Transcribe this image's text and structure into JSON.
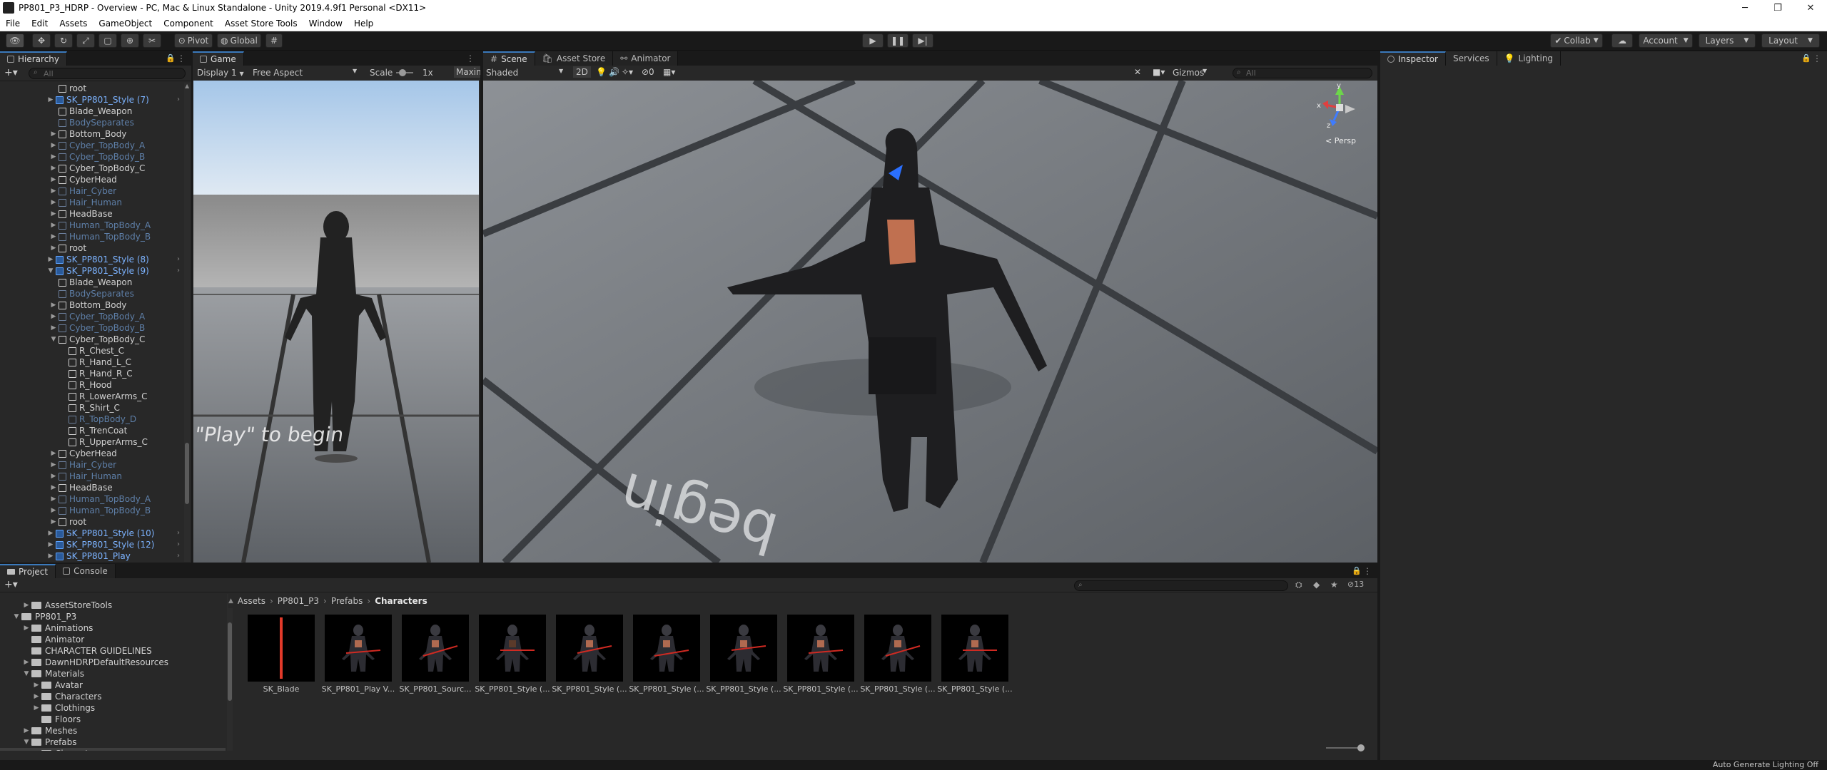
{
  "window": {
    "title": "PP801_P3_HDRP - Overview - PC, Mac & Linux Standalone - Unity 2019.4.9f1 Personal <DX11>"
  },
  "menu": [
    "File",
    "Edit",
    "Assets",
    "GameObject",
    "Component",
    "Asset Store Tools",
    "Window",
    "Help"
  ],
  "toolbar": {
    "pivot": "Pivot",
    "global": "Global",
    "collab": "Collab",
    "account": "Account",
    "layers": "Layers",
    "layout": "Layout"
  },
  "hierarchy": {
    "tab": "Hierarchy",
    "search_placeholder": "All",
    "rows": [
      {
        "label": "root",
        "depth": 1,
        "style": "white",
        "arrow": false,
        "icon": "normal"
      },
      {
        "label": "SK_PP801_Style (7)",
        "depth": 0,
        "style": "blue",
        "arrow": true,
        "icon": "blue",
        "chev": true
      },
      {
        "label": "Blade_Weapon",
        "depth": 1,
        "style": "white",
        "arrow": false,
        "icon": "normal"
      },
      {
        "label": "BodySeparates",
        "depth": 1,
        "style": "dim",
        "arrow": false,
        "icon": "dim"
      },
      {
        "label": "Bottom_Body",
        "depth": 1,
        "style": "white",
        "arrow": true,
        "icon": "normal"
      },
      {
        "label": "Cyber_TopBody_A",
        "depth": 1,
        "style": "dim",
        "arrow": true,
        "icon": "dim"
      },
      {
        "label": "Cyber_TopBody_B",
        "depth": 1,
        "style": "dim",
        "arrow": true,
        "icon": "dim"
      },
      {
        "label": "Cyber_TopBody_C",
        "depth": 1,
        "style": "white",
        "arrow": true,
        "icon": "normal"
      },
      {
        "label": "CyberHead",
        "depth": 1,
        "style": "white",
        "arrow": true,
        "icon": "normal"
      },
      {
        "label": "Hair_Cyber",
        "depth": 1,
        "style": "dim",
        "arrow": true,
        "icon": "dim"
      },
      {
        "label": "Hair_Human",
        "depth": 1,
        "style": "dim",
        "arrow": true,
        "icon": "dim"
      },
      {
        "label": "HeadBase",
        "depth": 1,
        "style": "white",
        "arrow": true,
        "icon": "normal"
      },
      {
        "label": "Human_TopBody_A",
        "depth": 1,
        "style": "dim",
        "arrow": true,
        "icon": "dim"
      },
      {
        "label": "Human_TopBody_B",
        "depth": 1,
        "style": "dim",
        "arrow": true,
        "icon": "dim"
      },
      {
        "label": "root",
        "depth": 1,
        "style": "white",
        "arrow": true,
        "icon": "normal"
      },
      {
        "label": "SK_PP801_Style (8)",
        "depth": 0,
        "style": "blue",
        "arrow": true,
        "icon": "blue",
        "chev": true
      },
      {
        "label": "SK_PP801_Style (9)",
        "depth": 0,
        "style": "blue",
        "arrow": true,
        "open": true,
        "icon": "blue",
        "chev": true
      },
      {
        "label": "Blade_Weapon",
        "depth": 1,
        "style": "white",
        "arrow": false,
        "icon": "normal"
      },
      {
        "label": "BodySeparates",
        "depth": 1,
        "style": "dim",
        "arrow": false,
        "icon": "dim"
      },
      {
        "label": "Bottom_Body",
        "depth": 1,
        "style": "white",
        "arrow": true,
        "icon": "normal"
      },
      {
        "label": "Cyber_TopBody_A",
        "depth": 1,
        "style": "dim",
        "arrow": true,
        "icon": "dim"
      },
      {
        "label": "Cyber_TopBody_B",
        "depth": 1,
        "style": "dim",
        "arrow": true,
        "icon": "dim"
      },
      {
        "label": "Cyber_TopBody_C",
        "depth": 1,
        "style": "white",
        "arrow": true,
        "open": true,
        "icon": "normal"
      },
      {
        "label": "R_Chest_C",
        "depth": 2,
        "style": "white",
        "arrow": false,
        "icon": "normal"
      },
      {
        "label": "R_Hand_L_C",
        "depth": 2,
        "style": "white",
        "arrow": false,
        "icon": "normal"
      },
      {
        "label": "R_Hand_R_C",
        "depth": 2,
        "style": "white",
        "arrow": false,
        "icon": "normal"
      },
      {
        "label": "R_Hood",
        "depth": 2,
        "style": "white",
        "arrow": false,
        "icon": "normal"
      },
      {
        "label": "R_LowerArms_C",
        "depth": 2,
        "style": "white",
        "arrow": false,
        "icon": "normal"
      },
      {
        "label": "R_Shirt_C",
        "depth": 2,
        "style": "white",
        "arrow": false,
        "icon": "normal"
      },
      {
        "label": "R_TopBody_D",
        "depth": 2,
        "style": "dim",
        "arrow": false,
        "icon": "dim"
      },
      {
        "label": "R_TrenCoat",
        "depth": 2,
        "style": "white",
        "arrow": false,
        "icon": "normal"
      },
      {
        "label": "R_UpperArms_C",
        "depth": 2,
        "style": "white",
        "arrow": false,
        "icon": "normal"
      },
      {
        "label": "CyberHead",
        "depth": 1,
        "style": "white",
        "arrow": true,
        "icon": "normal"
      },
      {
        "label": "Hair_Cyber",
        "depth": 1,
        "style": "dim",
        "arrow": true,
        "icon": "dim"
      },
      {
        "label": "Hair_Human",
        "depth": 1,
        "style": "dim",
        "arrow": true,
        "icon": "dim"
      },
      {
        "label": "HeadBase",
        "depth": 1,
        "style": "white",
        "arrow": true,
        "icon": "normal"
      },
      {
        "label": "Human_TopBody_A",
        "depth": 1,
        "style": "dim",
        "arrow": true,
        "icon": "dim"
      },
      {
        "label": "Human_TopBody_B",
        "depth": 1,
        "style": "dim",
        "arrow": true,
        "icon": "dim"
      },
      {
        "label": "root",
        "depth": 1,
        "style": "white",
        "arrow": true,
        "icon": "normal"
      },
      {
        "label": "SK_PP801_Style (10)",
        "depth": 0,
        "style": "blue",
        "arrow": true,
        "icon": "blue",
        "chev": true
      },
      {
        "label": "SK_PP801_Style (12)",
        "depth": 0,
        "style": "blue",
        "arrow": true,
        "icon": "blue",
        "chev": true
      },
      {
        "label": "SK_PP801_Play",
        "depth": 0,
        "style": "blue",
        "arrow": true,
        "icon": "blue",
        "chev": true
      }
    ]
  },
  "game": {
    "tab": "Game",
    "display": "Display 1",
    "aspect": "Free Aspect",
    "scale_label": "Scale",
    "scale_value": "1x",
    "maximize": "Maxim",
    "overlay": "\"Play\" to begin"
  },
  "scene": {
    "tab": "Scene",
    "asset_store_tab": "Asset Store",
    "animator_tab": "Animator",
    "shading": "Shaded",
    "mode2d": "2D",
    "gizmos": "Gizmos",
    "search_placeholder": "All",
    "persp": "< Persp",
    "gizmo_y": "y",
    "gizmo_x": "x",
    "gizmo_z": "z",
    "overlay": "begin"
  },
  "inspector": {
    "tab": "Inspector",
    "services_tab": "Services",
    "lighting_tab": "Lighting"
  },
  "project": {
    "tab": "Project",
    "console_tab": "Console",
    "hidden_count": "13",
    "breadcrumb": [
      "Assets",
      "PP801_P3",
      "Prefabs",
      "Characters"
    ],
    "tree": [
      {
        "label": "AssetStoreTools",
        "depth": 1,
        "arrow": true
      },
      {
        "label": "PP801_P3",
        "depth": 0,
        "arrow": true,
        "open": true
      },
      {
        "label": "Animations",
        "depth": 1,
        "arrow": true
      },
      {
        "label": "Animator",
        "depth": 1,
        "arrow": false
      },
      {
        "label": "CHARACTER GUIDELINES",
        "depth": 1,
        "arrow": false
      },
      {
        "label": "DawnHDRPDefaultResources",
        "depth": 1,
        "arrow": true
      },
      {
        "label": "Materials",
        "depth": 1,
        "arrow": true,
        "open": true
      },
      {
        "label": "Avatar",
        "depth": 2,
        "arrow": true
      },
      {
        "label": "Characters",
        "depth": 2,
        "arrow": true
      },
      {
        "label": "Clothings",
        "depth": 2,
        "arrow": true
      },
      {
        "label": "Floors",
        "depth": 2,
        "arrow": false
      },
      {
        "label": "Meshes",
        "depth": 1,
        "arrow": true
      },
      {
        "label": "Prefabs",
        "depth": 1,
        "arrow": true,
        "open": true
      },
      {
        "label": "Characters",
        "depth": 2,
        "arrow": false,
        "selected": true
      }
    ],
    "assets": [
      "SK_Blade",
      "SK_PP801_Play V...",
      "SK_PP801_Sourc...",
      "SK_PP801_Style (...",
      "SK_PP801_Style (...",
      "SK_PP801_Style (...",
      "SK_PP801_Style (...",
      "SK_PP801_Style (...",
      "SK_PP801_Style (...",
      "SK_PP801_Style (..."
    ]
  },
  "status": {
    "text": "Auto Generate Lighting Off"
  }
}
